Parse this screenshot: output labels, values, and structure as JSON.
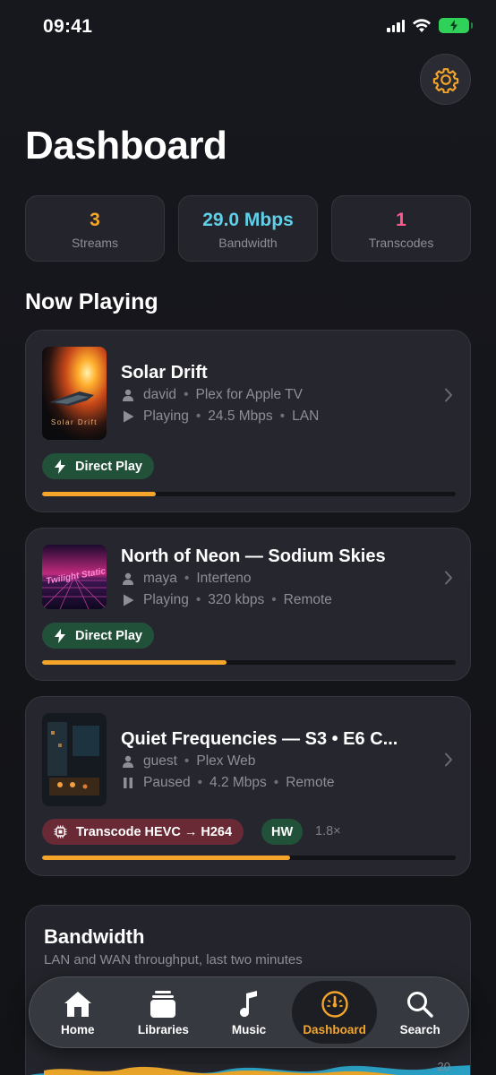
{
  "status_bar": {
    "time": "09:41"
  },
  "colors": {
    "accent": "#f4a52a",
    "streams": "#f4a52a",
    "bandwidth": "#5fd0e8",
    "transcodes": "#ff5a8a",
    "direct_play": "#22513a",
    "transcode": "#6a2a35"
  },
  "header": {
    "title": "Dashboard",
    "settings_icon": "gear-icon"
  },
  "stats": [
    {
      "value": "3",
      "label": "Streams"
    },
    {
      "value": "29.0 Mbps",
      "label": "Bandwidth"
    },
    {
      "value": "1",
      "label": "Transcodes"
    }
  ],
  "now_playing": {
    "title": "Now Playing",
    "streams": [
      {
        "title": "Solar Drift",
        "poster_text": "Solar Drift",
        "user": "david",
        "client": "Plex for Apple TV",
        "state": "Playing",
        "bitrate": "24.5 Mbps",
        "network": "LAN",
        "badge": "Direct Play",
        "progress": 0.275
      },
      {
        "title": "North of Neon — Sodium Skies",
        "poster_text": "Twilight Static",
        "user": "maya",
        "client": "Interteno",
        "state": "Playing",
        "bitrate": "320 kbps",
        "network": "Remote",
        "badge": "Direct Play",
        "progress": 0.445
      },
      {
        "title": "Quiet Frequencies — S3 • E6 C...",
        "user": "guest",
        "client": "Plex Web",
        "state": "Paused",
        "bitrate": "4.2 Mbps",
        "network": "Remote",
        "badge": "Transcode HEVC → H264",
        "hw_badge": "HW",
        "speed": "1.8×",
        "progress": 0.6
      }
    ]
  },
  "bandwidth_card": {
    "title": "Bandwidth",
    "subtitle": "LAN and WAN throughput, last two minutes",
    "tick": "20"
  },
  "tabbar": [
    {
      "label": "Home",
      "icon": "house-icon"
    },
    {
      "label": "Libraries",
      "icon": "stack-icon"
    },
    {
      "label": "Music",
      "icon": "music-note-icon"
    },
    {
      "label": "Dashboard",
      "icon": "gauge-icon",
      "active": true
    },
    {
      "label": "Search",
      "icon": "search-icon"
    }
  ]
}
